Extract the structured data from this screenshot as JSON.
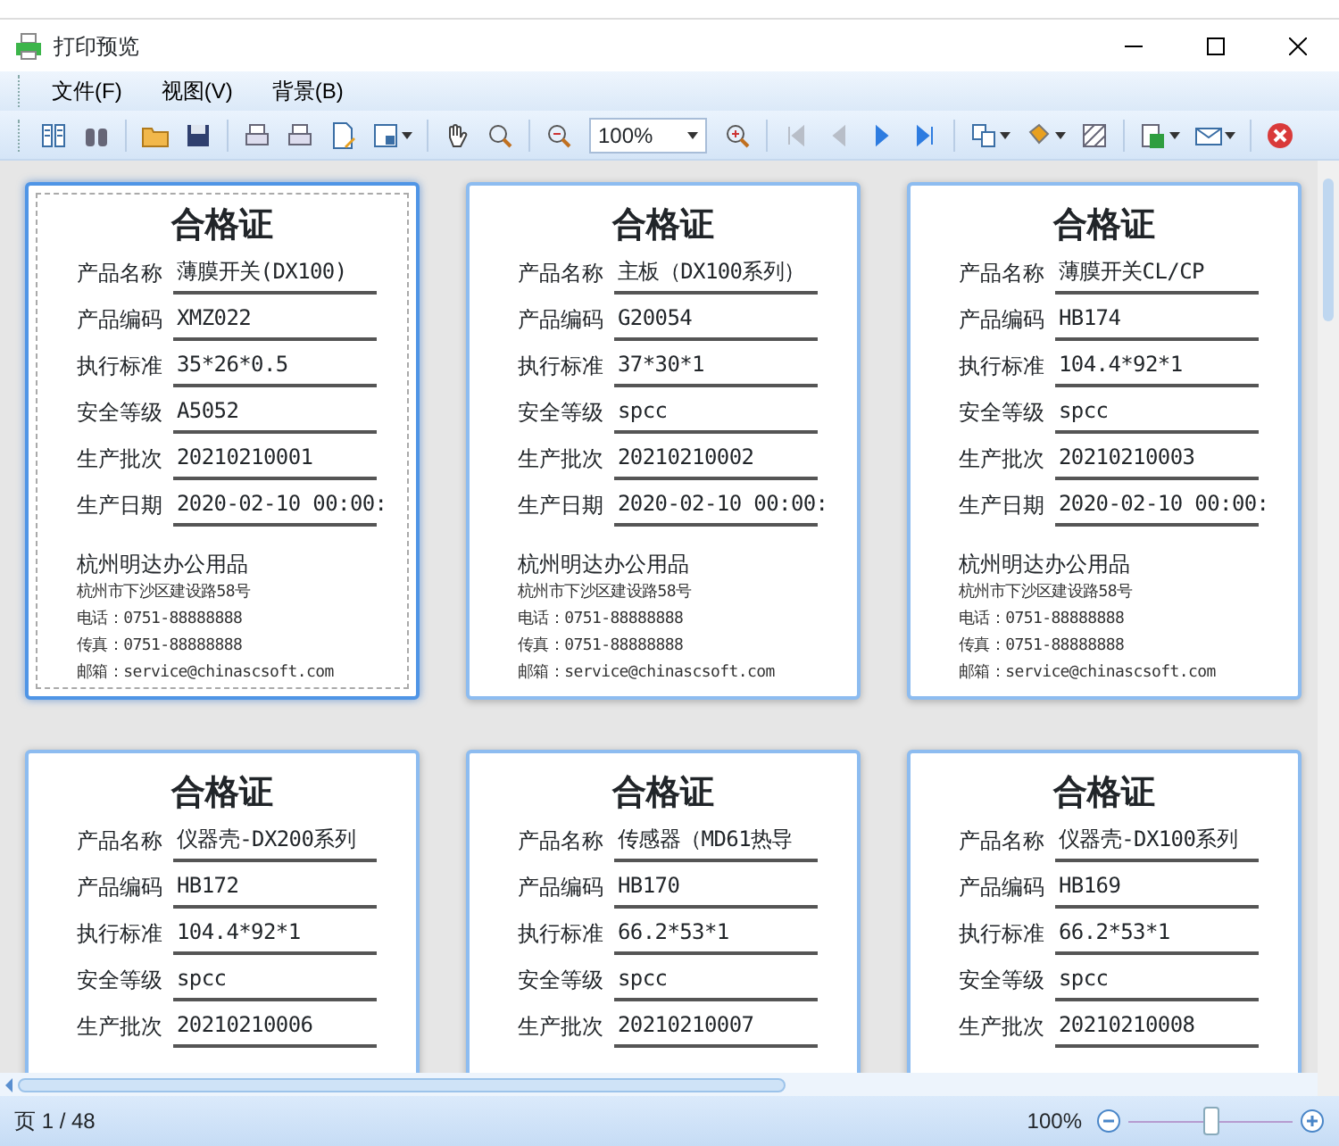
{
  "window": {
    "title": "打印预览"
  },
  "menu": [
    {
      "label": "文件(F)"
    },
    {
      "label": "视图(V)"
    },
    {
      "label": "背景(B)"
    }
  ],
  "toolbar": {
    "zoom": "100%",
    "nav": [
      {
        "disabled": true
      },
      {
        "disabled": true
      },
      {
        "disabled": false
      },
      {
        "disabled": false
      }
    ]
  },
  "pages": [
    {
      "selected": true,
      "title": "合格证",
      "fields": [
        {
          "label": "产品名称",
          "value": "薄膜开关(DX100)"
        },
        {
          "label": "产品编码",
          "value": "XMZ022"
        },
        {
          "label": "执行标准",
          "value": "35*26*0.5"
        },
        {
          "label": "安全等级",
          "value": "A5052"
        },
        {
          "label": "生产批次",
          "value": "20210210001"
        },
        {
          "label": "生产日期",
          "value": "2020-02-10 00:00:"
        }
      ],
      "company": "杭州明达办公用品",
      "address": "杭州市下沙区建设路58号",
      "phone": "电话：0751-88888888",
      "fax": "传真：0751-88888888",
      "email": "邮箱：service@chinascsoft.com"
    },
    {
      "selected": false,
      "title": "合格证",
      "fields": [
        {
          "label": "产品名称",
          "value": "主板（DX100系列）"
        },
        {
          "label": "产品编码",
          "value": "G20054"
        },
        {
          "label": "执行标准",
          "value": "37*30*1"
        },
        {
          "label": "安全等级",
          "value": "spcc"
        },
        {
          "label": "生产批次",
          "value": "20210210002"
        },
        {
          "label": "生产日期",
          "value": "2020-02-10 00:00:"
        }
      ],
      "company": "杭州明达办公用品",
      "address": "杭州市下沙区建设路58号",
      "phone": "电话：0751-88888888",
      "fax": "传真：0751-88888888",
      "email": "邮箱：service@chinascsoft.com"
    },
    {
      "selected": false,
      "title": "合格证",
      "fields": [
        {
          "label": "产品名称",
          "value": "薄膜开关CL/CP"
        },
        {
          "label": "产品编码",
          "value": "HB174"
        },
        {
          "label": "执行标准",
          "value": "104.4*92*1"
        },
        {
          "label": "安全等级",
          "value": "spcc"
        },
        {
          "label": "生产批次",
          "value": "20210210003"
        },
        {
          "label": "生产日期",
          "value": "2020-02-10 00:00:"
        }
      ],
      "company": "杭州明达办公用品",
      "address": "杭州市下沙区建设路58号",
      "phone": "电话：0751-88888888",
      "fax": "传真：0751-88888888",
      "email": "邮箱：service@chinascsoft.com"
    },
    {
      "selected": false,
      "title": "合格证",
      "fields": [
        {
          "label": "产品名称",
          "value": "仪器壳-DX200系列"
        },
        {
          "label": "产品编码",
          "value": "HB172"
        },
        {
          "label": "执行标准",
          "value": "104.4*92*1"
        },
        {
          "label": "安全等级",
          "value": "spcc"
        },
        {
          "label": "生产批次",
          "value": "20210210006"
        }
      ]
    },
    {
      "selected": false,
      "title": "合格证",
      "fields": [
        {
          "label": "产品名称",
          "value": "传感器（MD61热导"
        },
        {
          "label": "产品编码",
          "value": "HB170"
        },
        {
          "label": "执行标准",
          "value": "66.2*53*1"
        },
        {
          "label": "安全等级",
          "value": "spcc"
        },
        {
          "label": "生产批次",
          "value": "20210210007"
        }
      ]
    },
    {
      "selected": false,
      "title": "合格证",
      "fields": [
        {
          "label": "产品名称",
          "value": "仪器壳-DX100系列"
        },
        {
          "label": "产品编码",
          "value": "HB169"
        },
        {
          "label": "执行标准",
          "value": "66.2*53*1"
        },
        {
          "label": "安全等级",
          "value": "spcc"
        },
        {
          "label": "生产批次",
          "value": "20210210008"
        }
      ]
    }
  ],
  "status_bar": {
    "page": "页 1 / 48",
    "zoom": "100%",
    "zoom_slider": {
      "level": 0.5
    }
  }
}
